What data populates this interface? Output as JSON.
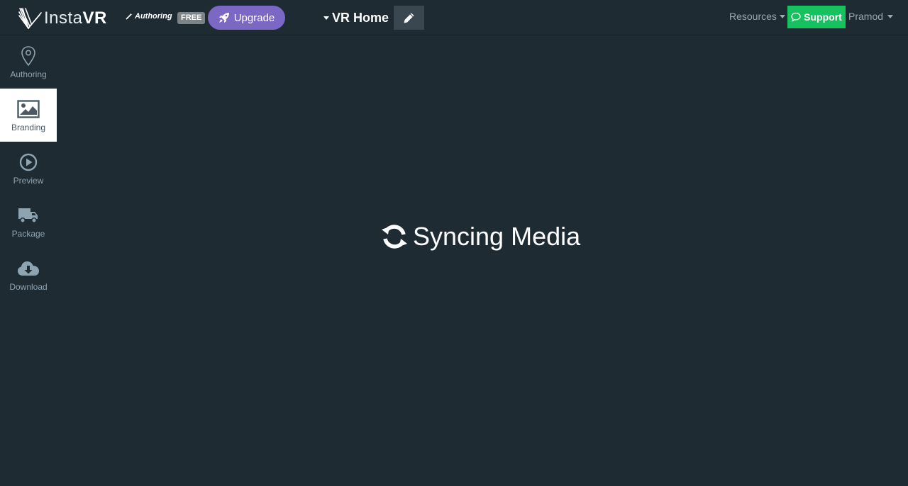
{
  "header": {
    "brand_light": "Insta",
    "brand_bold": "VR",
    "mode_label": "Authoring",
    "plan_badge": "FREE",
    "upgrade_label": "Upgrade",
    "project_title": "VR Home",
    "resources_label": "Resources",
    "support_label": "Support",
    "user_name": "Pramod"
  },
  "sidebar": {
    "items": [
      {
        "label": "Authoring",
        "icon": "map-pin-icon",
        "active": false
      },
      {
        "label": "Branding",
        "icon": "image-icon",
        "active": true
      },
      {
        "label": "Preview",
        "icon": "play-circle-icon",
        "active": false
      },
      {
        "label": "Package",
        "icon": "truck-icon",
        "active": false
      },
      {
        "label": "Download",
        "icon": "cloud-download-icon",
        "active": false
      }
    ]
  },
  "main": {
    "status_text": "Syncing Media",
    "status_icon": "sync-icon"
  },
  "colors": {
    "background": "#1e2b33",
    "upgrade": "#7a68c4",
    "support": "#16c15f",
    "sidebar_text": "#8fa4b1"
  }
}
